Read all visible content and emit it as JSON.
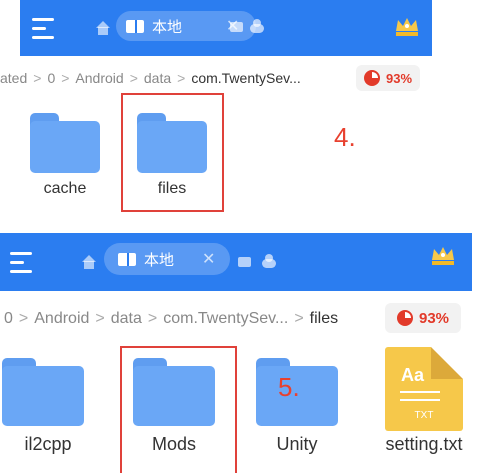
{
  "panel1": {
    "tab_label": "本地",
    "breadcrumb": [
      "ated",
      "0",
      "Android",
      "data",
      "com.TwentySev..."
    ],
    "storage_percent": "93%",
    "items": [
      {
        "name": "cache",
        "type": "folder"
      },
      {
        "name": "files",
        "type": "folder"
      }
    ],
    "step_label": "4."
  },
  "panel2": {
    "tab_label": "本地",
    "breadcrumb": [
      "0",
      "Android",
      "data",
      "com.TwentySev...",
      "files"
    ],
    "storage_percent": "93%",
    "items": [
      {
        "name": "il2cpp",
        "type": "folder"
      },
      {
        "name": "Mods",
        "type": "folder"
      },
      {
        "name": "Unity",
        "type": "folder"
      },
      {
        "name": "setting.txt",
        "type": "text-file",
        "icon_text": "Aa",
        "ext_text": "TXT"
      }
    ],
    "step_label": "5."
  },
  "colors": {
    "toolbar": "#2b7df0",
    "folder": "#6aa7f6",
    "highlight": "#e0413a",
    "storage": "#e23a2a"
  }
}
